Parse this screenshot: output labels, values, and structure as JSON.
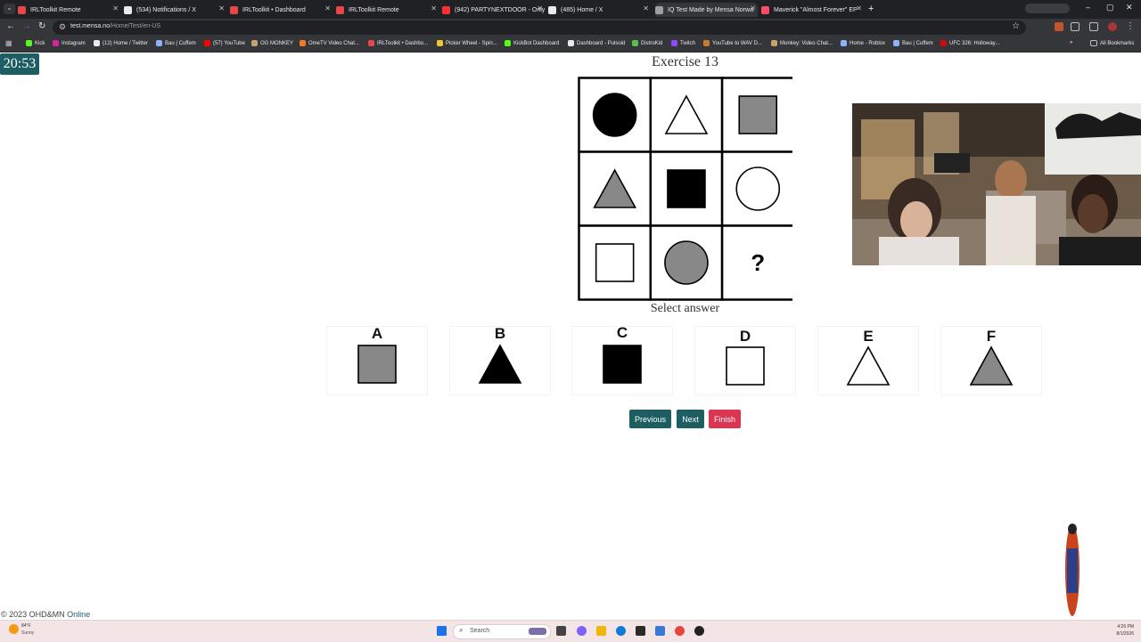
{
  "browser": {
    "tabs": [
      {
        "label": "IRLToolkit Remote",
        "color": "#e8474a"
      },
      {
        "label": "(534) Notifications / X",
        "color": "#e8eaed"
      },
      {
        "label": "IRLToolkit • Dashboard",
        "color": "#e8474a"
      },
      {
        "label": "IRLToolkit Remote",
        "color": "#e8474a"
      },
      {
        "label": "(942) PARTYNEXTDOOR - Only",
        "color": "#ff3030"
      },
      {
        "label": "(485) Home / X",
        "color": "#e8eaed"
      },
      {
        "label": "IQ Test Made by Mensa Norwa",
        "color": "#9aa0a6"
      },
      {
        "label": "Maverick \"Almost Forever\" EP",
        "color": "#fa4d6a"
      }
    ],
    "url_host": "test.mensa.no",
    "url_path": "/Home/Test/en-US",
    "bookmarks": [
      {
        "label": "Kick",
        "color": "#53fc18"
      },
      {
        "label": "Instagram",
        "color": "#d6249f"
      },
      {
        "label": "(12) Home / Twitter",
        "color": "#e8eaed"
      },
      {
        "label": "Bau | Cuffem",
        "color": "#8ab4f8"
      },
      {
        "label": "(57) YouTube",
        "color": "#ff0000"
      },
      {
        "label": "OG MONKEY",
        "color": "#c7a36b"
      },
      {
        "label": "OmeTV Video Chat...",
        "color": "#f27b2a"
      },
      {
        "label": "IRLToolkit • Dashbo...",
        "color": "#e8474a"
      },
      {
        "label": "Picker Wheel - Spin...",
        "color": "#f4c430"
      },
      {
        "label": "KickBot Dashboard",
        "color": "#53fc18"
      },
      {
        "label": "Dashboard - Pulsoid",
        "color": "#e8eaed"
      },
      {
        "label": "DistroKid",
        "color": "#5bbd4a"
      },
      {
        "label": "Twitch",
        "color": "#9146ff"
      },
      {
        "label": "YouTube to WAV D...",
        "color": "#c77d2e"
      },
      {
        "label": "Monkey: Video Chat...",
        "color": "#c7a36b"
      },
      {
        "label": "Home - Roblox",
        "color": "#8ab4f8"
      },
      {
        "label": "Bau | Cuffem",
        "color": "#8ab4f8"
      },
      {
        "label": "UFC 326: Holloway...",
        "color": "#d20a0a"
      }
    ],
    "all_bookmarks_label": "All Bookmarks",
    "more_bookmarks_label": "»"
  },
  "page": {
    "timer": "20:53",
    "exercise_title": "Exercise 13",
    "question_mark": "?",
    "select_answer": "Select answer",
    "grid": [
      [
        "black-circle",
        "white-triangle",
        "gray-square"
      ],
      [
        "gray-triangle",
        "black-square",
        "white-circle"
      ],
      [
        "white-square",
        "gray-circle",
        "question"
      ]
    ],
    "options": [
      {
        "letter": "A",
        "shape": "gray-square"
      },
      {
        "letter": "B",
        "shape": "black-triangle"
      },
      {
        "letter": "C",
        "shape": "black-square"
      },
      {
        "letter": "D",
        "shape": "white-square"
      },
      {
        "letter": "E",
        "shape": "white-triangle"
      },
      {
        "letter": "F",
        "shape": "gray-triangle"
      }
    ],
    "buttons": {
      "previous": "Previous",
      "next": "Next",
      "finish": "Finish"
    },
    "footer": {
      "copyright": "© 2023 OHD&MN",
      "link": "Online"
    }
  },
  "taskbar": {
    "weather_temp": "84°F",
    "weather_cond": "Sunny",
    "search_label": "Search",
    "time": "4:26 PM",
    "date": "8/1/2026"
  },
  "colors": {
    "accent": "#1d5e63",
    "finish": "#dc3552",
    "gray_shape": "#888888"
  }
}
